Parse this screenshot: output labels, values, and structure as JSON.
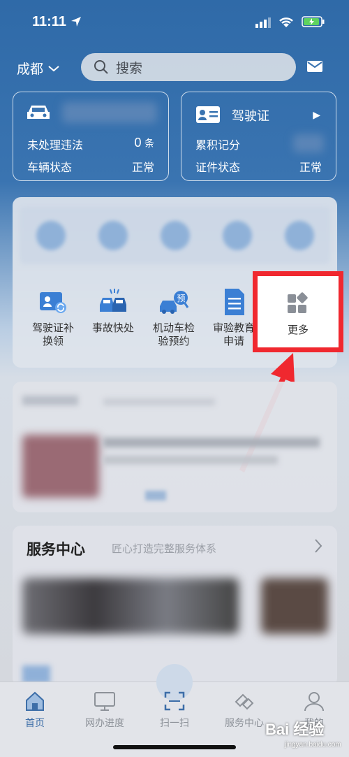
{
  "status_bar": {
    "time": "11:11"
  },
  "header": {
    "city": "成都",
    "search_placeholder": "搜索"
  },
  "vehicle_card": {
    "violations_label": "未处理违法",
    "violations_value": "0",
    "violations_unit": "条",
    "status_label": "车辆状态",
    "status_value": "正常"
  },
  "license_card": {
    "title": "驾驶证",
    "points_label": "累积记分",
    "status_label": "证件状态",
    "status_value": "正常"
  },
  "services": [
    {
      "label_line1": "驾驶证补",
      "label_line2": "换领",
      "icon": "license-renew-icon"
    },
    {
      "label_line1": "事故快处",
      "label_line2": "",
      "icon": "accident-icon"
    },
    {
      "label_line1": "机动车检",
      "label_line2": "验预约",
      "icon": "inspection-booking-icon"
    },
    {
      "label_line1": "审验教育",
      "label_line2": "申请",
      "icon": "education-doc-icon"
    }
  ],
  "more": {
    "label": "更多",
    "icon": "more-grid-icon"
  },
  "service_center": {
    "title": "服务中心",
    "subtitle": "匠心打造完整服务体系"
  },
  "tabs": [
    {
      "label": "首页",
      "icon": "home-icon",
      "active": true
    },
    {
      "label": "网办进度",
      "icon": "monitor-icon",
      "active": false
    },
    {
      "label": "扫一扫",
      "icon": "scan-icon",
      "active": false
    },
    {
      "label": "服务中心",
      "icon": "service-icon",
      "active": false
    },
    {
      "label": "我的",
      "icon": "user-icon",
      "active": false
    }
  ],
  "watermark": {
    "text": "Bai 经验",
    "sub": "jingyan.baidu.com"
  },
  "colors": {
    "primary": "#2f6aa8",
    "highlight": "#f0282f",
    "active_tab": "#3d6ea8"
  }
}
